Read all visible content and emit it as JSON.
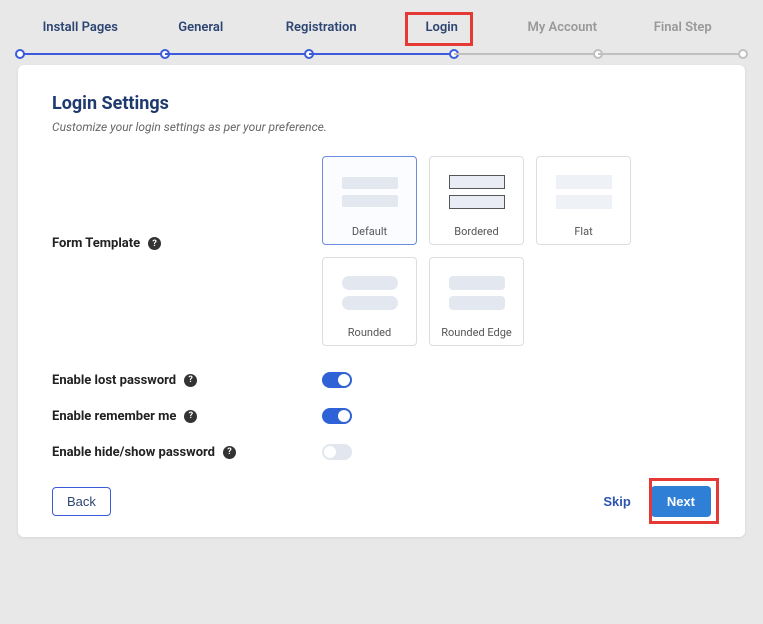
{
  "stepper": {
    "steps": [
      {
        "label": "Install Pages",
        "active": true
      },
      {
        "label": "General",
        "active": true
      },
      {
        "label": "Registration",
        "active": true
      },
      {
        "label": "Login",
        "active": true,
        "current": true
      },
      {
        "label": "My Account",
        "active": false
      },
      {
        "label": "Final Step",
        "active": false
      }
    ]
  },
  "page": {
    "title": "Login Settings",
    "subtitle": "Customize your login settings as per your preference."
  },
  "form_template": {
    "label": "Form Template",
    "options": [
      {
        "name": "Default",
        "selected": true,
        "style": "default"
      },
      {
        "name": "Bordered",
        "selected": false,
        "style": "bordered"
      },
      {
        "name": "Flat",
        "selected": false,
        "style": "flat"
      },
      {
        "name": "Rounded",
        "selected": false,
        "style": "rounded"
      },
      {
        "name": "Rounded Edge",
        "selected": false,
        "style": "rounded-edge"
      }
    ]
  },
  "toggles": {
    "lost_password": {
      "label": "Enable lost password",
      "on": true
    },
    "remember_me": {
      "label": "Enable remember me",
      "on": true
    },
    "hide_show_password": {
      "label": "Enable hide/show password",
      "on": false
    }
  },
  "footer": {
    "back": "Back",
    "skip": "Skip",
    "next": "Next"
  }
}
